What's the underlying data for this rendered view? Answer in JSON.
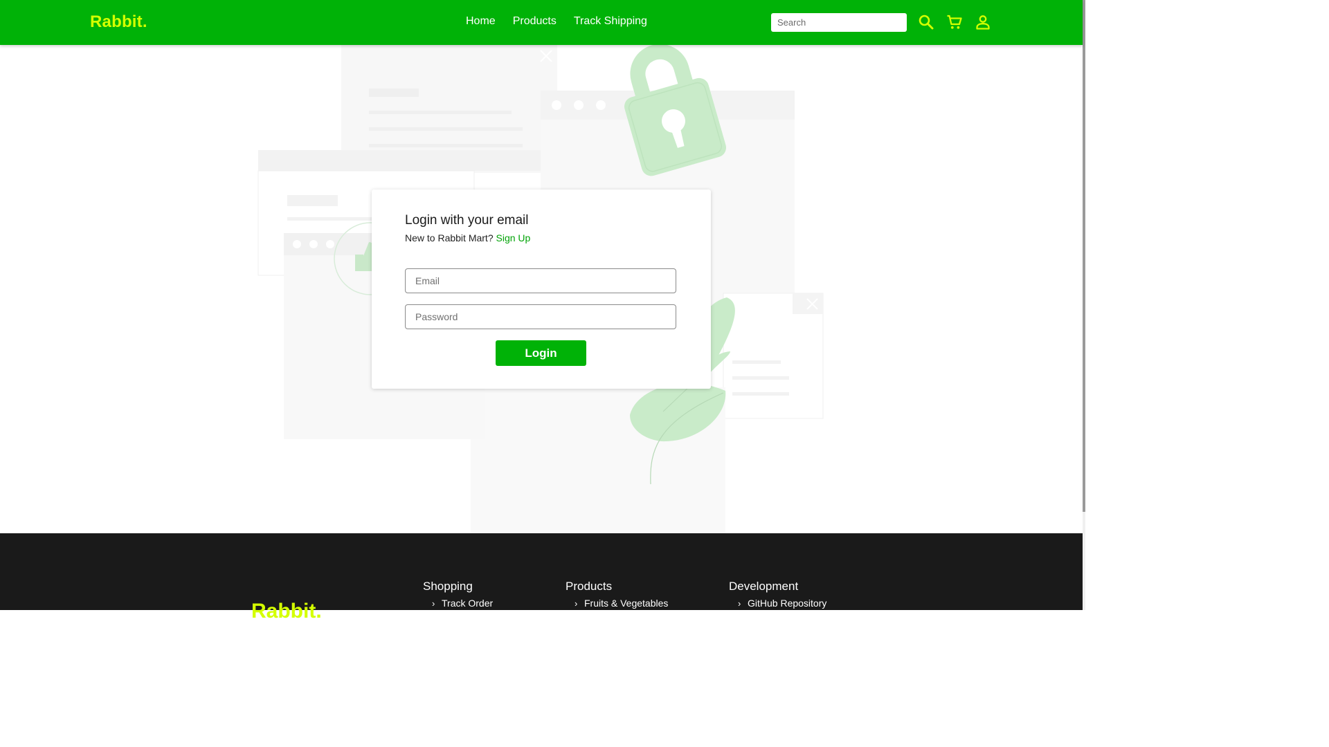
{
  "navbar": {
    "brand": "Rabbit.",
    "links": [
      "Home",
      "Products",
      "Track Shipping"
    ],
    "search_placeholder": "Search",
    "icons": [
      "search-icon",
      "cart-icon",
      "user-icon"
    ],
    "bg_color": "#00b207",
    "brand_color": "#d4ff00"
  },
  "login": {
    "title": "Login with your email",
    "new_text": "New to Rabbit Mart?",
    "signup_link": "Sign Up",
    "email_placeholder": "Email",
    "password_placeholder": "Password",
    "button": "Login"
  },
  "footer": {
    "brand": "Rabbit.",
    "columns": [
      {
        "heading": "Shopping",
        "items": [
          "Track Order"
        ]
      },
      {
        "heading": "Products",
        "items": [
          "Fruits & Vegetables"
        ]
      },
      {
        "heading": "Development",
        "items": [
          "GitHub Repository"
        ]
      }
    ],
    "bg_color": "#1a1a1a"
  }
}
